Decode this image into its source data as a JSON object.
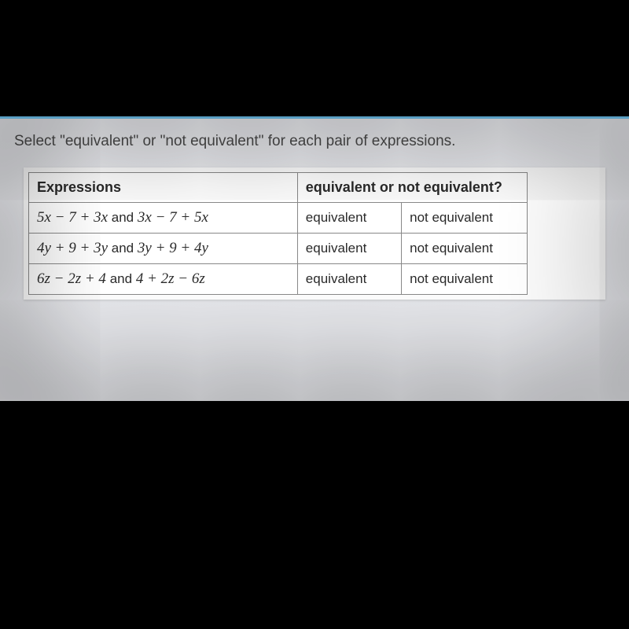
{
  "instruction": "Select \"equivalent\" or \"not equivalent\" for each pair of expressions.",
  "table": {
    "header": {
      "col1": "Expressions",
      "col2": "equivalent or not equivalent?"
    },
    "rows": [
      {
        "expr_a": "5x − 7 + 3x",
        "expr_b": "3x − 7 + 5x",
        "joiner": "and",
        "opt1": "equivalent",
        "opt2": "not equivalent"
      },
      {
        "expr_a": "4y + 9 + 3y",
        "expr_b": "3y + 9 + 4y",
        "joiner": "and",
        "opt1": "equivalent",
        "opt2": "not equivalent"
      },
      {
        "expr_a": "6z − 2z + 4",
        "expr_b": "4 + 2z − 6z",
        "joiner": "and",
        "opt1": "equivalent",
        "opt2": "not equivalent"
      }
    ]
  }
}
